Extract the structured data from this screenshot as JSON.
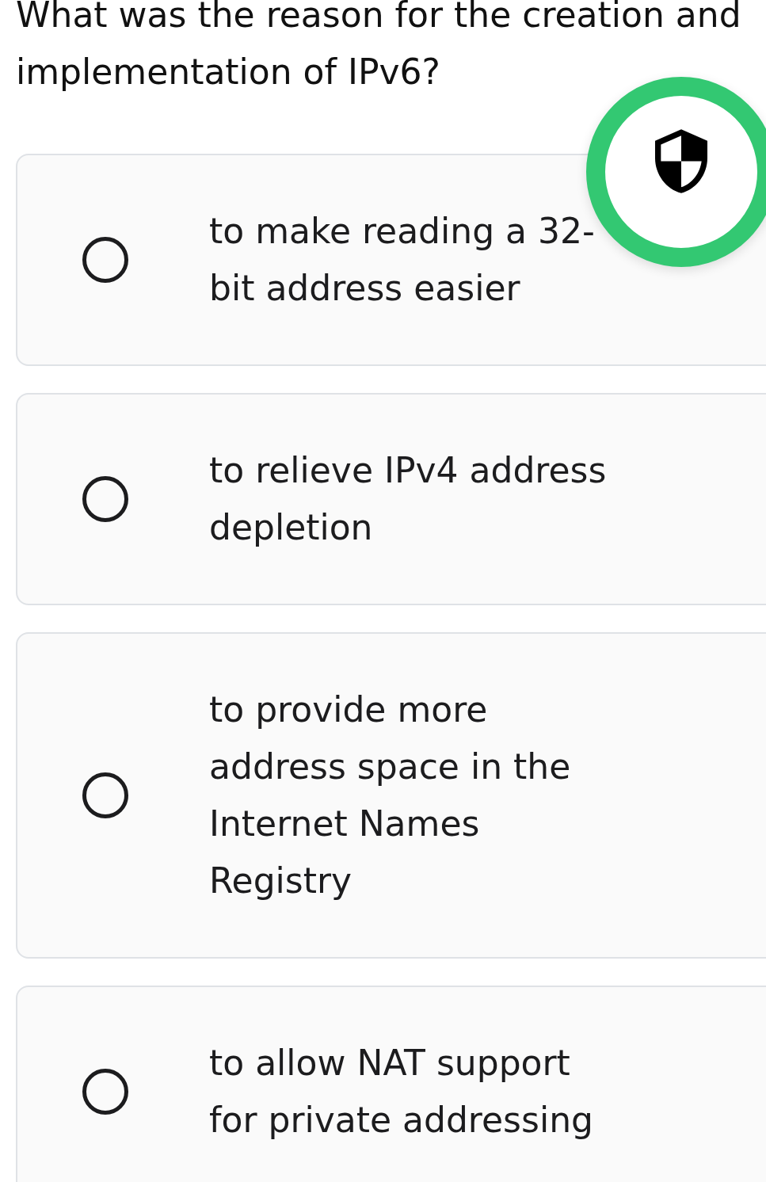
{
  "question": "What was the reason for the creation and implementation of IPv6?",
  "options": [
    {
      "text": "to make reading a 32-bit address easier",
      "selected": false
    },
    {
      "text": "to relieve IPv4 address depletion",
      "selected": false
    },
    {
      "text": "to provide more address space in the Internet Names Registry",
      "selected": false
    },
    {
      "text": "to allow NAT support for private addressing",
      "selected": false
    }
  ]
}
